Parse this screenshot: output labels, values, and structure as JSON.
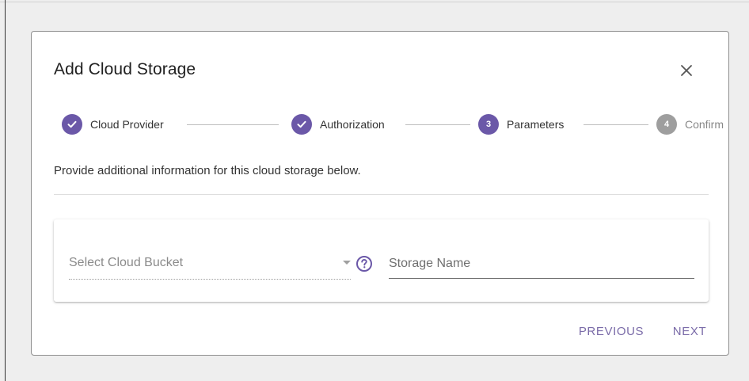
{
  "colors": {
    "accent": "#6b58a8",
    "inactive_step": "#9e9e9e",
    "action_text": "#7a6ba8"
  },
  "dialog": {
    "title": "Add Cloud Storage",
    "close_icon": "close-icon"
  },
  "stepper": {
    "steps": [
      {
        "label": "Cloud Provider",
        "status": "completed",
        "icon": "check-icon",
        "number": ""
      },
      {
        "label": "Authorization",
        "status": "completed",
        "icon": "check-icon",
        "number": ""
      },
      {
        "label": "Parameters",
        "status": "active",
        "icon": "",
        "number": "3"
      },
      {
        "label": "Confirm",
        "status": "pending",
        "icon": "",
        "number": "4"
      }
    ]
  },
  "instructions": "Provide additional information for this cloud storage below.",
  "form": {
    "bucket_select": {
      "placeholder": "Select Cloud Bucket",
      "value": "",
      "icon": "dropdown-arrow-icon"
    },
    "help_icon": "help-circle-icon",
    "storage_name": {
      "placeholder": "Storage Name",
      "value": ""
    }
  },
  "actions": {
    "previous_label": "PREVIOUS",
    "next_label": "NEXT"
  }
}
